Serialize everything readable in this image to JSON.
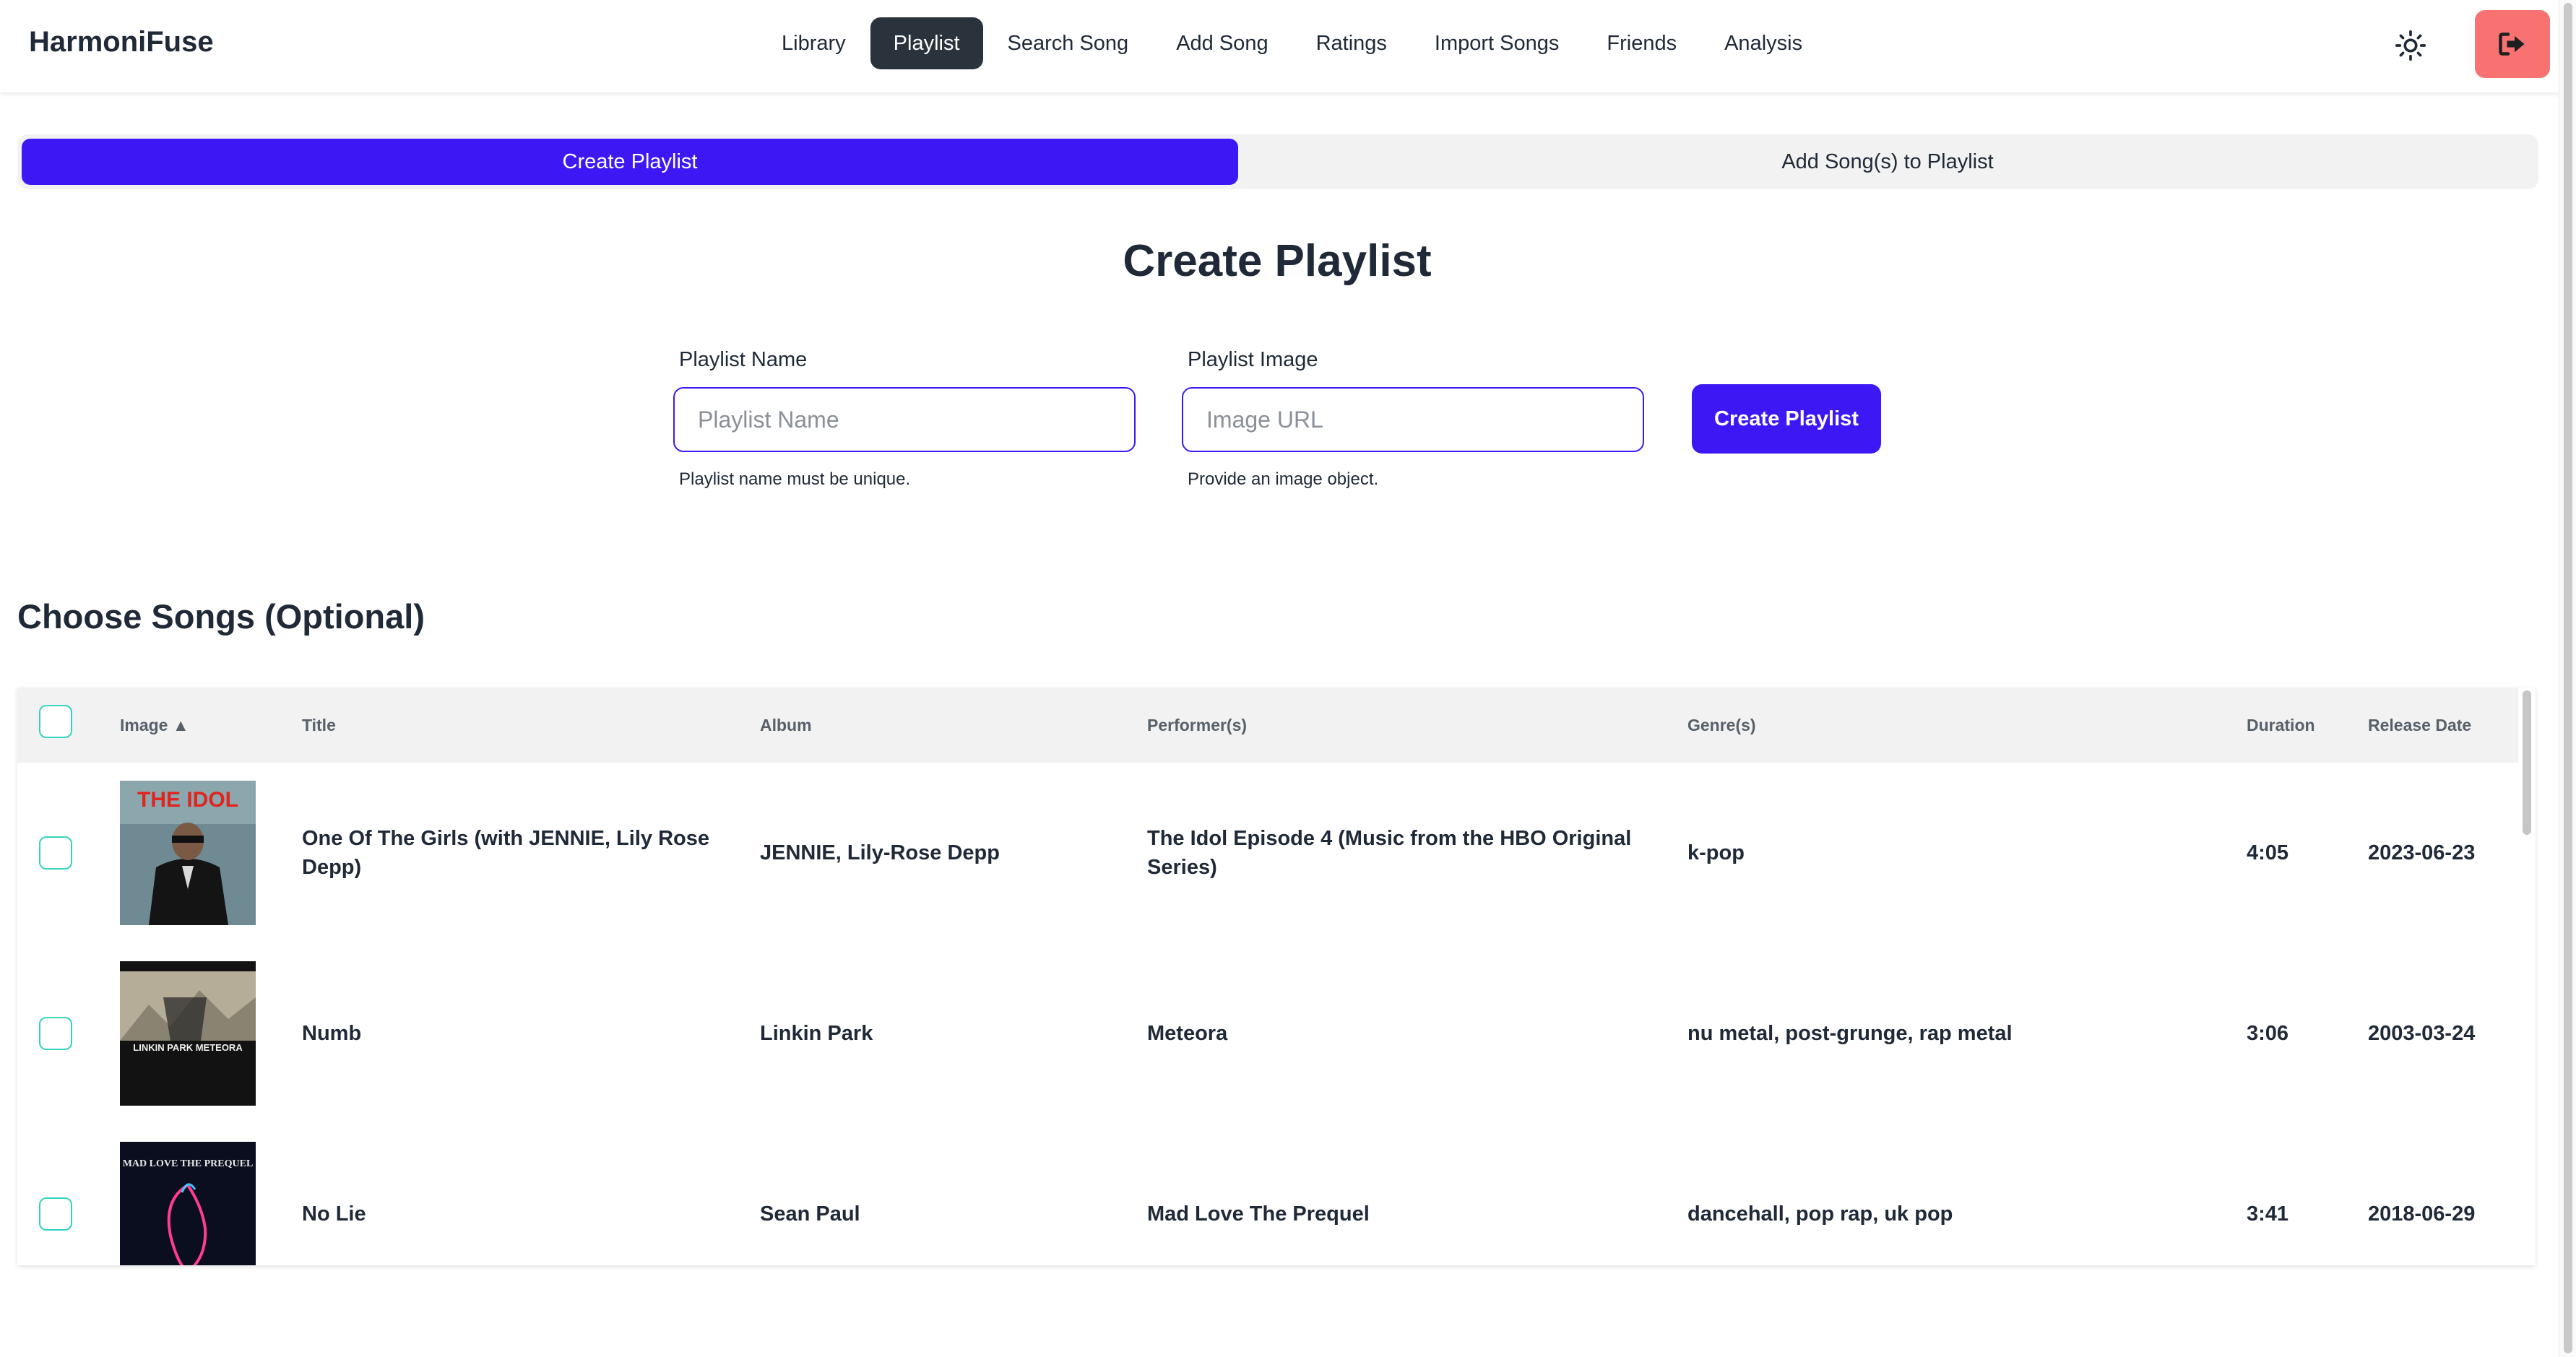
{
  "app": {
    "brand": "HarmoniFuse"
  },
  "nav": {
    "links": [
      "Library",
      "Playlist",
      "Search Song",
      "Add Song",
      "Ratings",
      "Import Songs",
      "Friends",
      "Analysis"
    ],
    "active": "Playlist",
    "theme_icon": "sun-icon",
    "logout_icon": "logout-icon"
  },
  "tabs": {
    "create": "Create Playlist",
    "add": "Add Song(s) to Playlist",
    "active": "create"
  },
  "form": {
    "title": "Create Playlist",
    "name_label": "Playlist Name",
    "name_placeholder": "Playlist Name",
    "name_value": "",
    "name_help": "Playlist name must be unique.",
    "image_label": "Playlist Image",
    "image_placeholder": "Image URL",
    "image_value": "",
    "image_help": "Provide an image object.",
    "submit_label": "Create Playlist"
  },
  "songs": {
    "section_title": "Choose Songs (Optional)",
    "headers": {
      "image": "Image ▲",
      "title": "Title",
      "album": "Album",
      "performers": "Performer(s)",
      "genres": "Genre(s)",
      "duration": "Duration",
      "release_date": "Release Date"
    },
    "rows": [
      {
        "title": "One Of The Girls (with JENNIE, Lily Rose Depp)",
        "album": "JENNIE, Lily-Rose Depp",
        "performers": "The Idol Episode 4 (Music from the HBO Original Series)",
        "genres": "k-pop",
        "duration": "4:05",
        "release_date": "2023-06-23",
        "checked": false,
        "cover_text": "THE IDOL"
      },
      {
        "title": "Numb",
        "album": "Linkin Park",
        "performers": "Meteora",
        "genres": "nu metal, post-grunge, rap metal",
        "duration": "3:06",
        "release_date": "2003-03-24",
        "checked": false,
        "cover_text": "LINKIN PARK METEORA"
      },
      {
        "title": "No Lie",
        "album": "Sean Paul",
        "performers": "Mad Love The Prequel",
        "genres": "dancehall, pop rap, uk pop",
        "duration": "3:41",
        "release_date": "2018-06-29",
        "checked": false,
        "cover_text": "MAD LOVE THE PREQUEL"
      }
    ]
  },
  "colors": {
    "primary": "#3d18f5",
    "nav_active": "#2a323c",
    "logout": "#f87272",
    "checkbox": "#36d3c1"
  }
}
